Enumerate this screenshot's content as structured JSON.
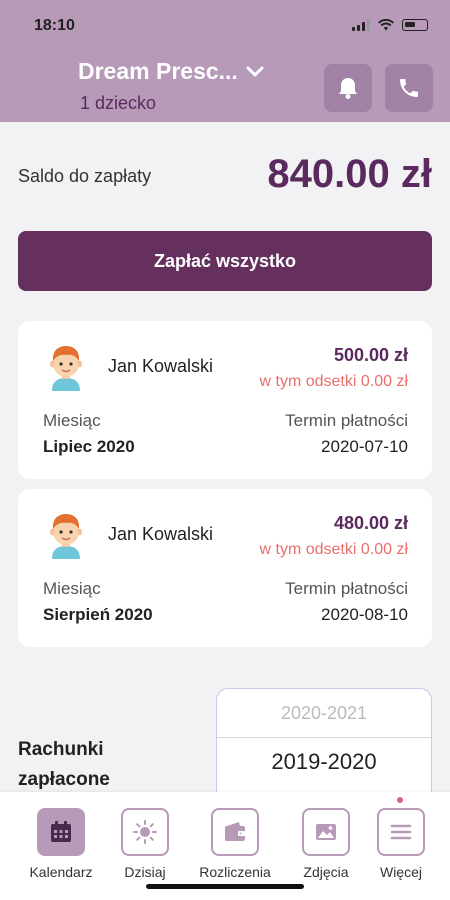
{
  "status_bar": {
    "time": "18:10"
  },
  "header": {
    "school_name": "Dream Presc...",
    "children_count": "1 dziecko"
  },
  "balance": {
    "label": "Saldo do zapłaty",
    "value": "840.00 zł"
  },
  "pay_all_label": "Zapłać wszystko",
  "payments": [
    {
      "child_name": "Jan Kowalski",
      "amount": "500.00 zł",
      "interest": "w tym odsetki 0.00 zł",
      "month_label": "Miesiąc",
      "month_value": "Lipiec 2020",
      "due_label": "Termin płatności",
      "due_value": "2020-07-10"
    },
    {
      "child_name": "Jan Kowalski",
      "amount": "480.00 zł",
      "interest": "w tym odsetki 0.00 zł",
      "month_label": "Miesiąc",
      "month_value": "Sierpień 2020",
      "due_label": "Termin płatności",
      "due_value": "2020-08-10"
    }
  ],
  "paid_section": {
    "label_line1": "Rachunki",
    "label_line2": "zapłacone",
    "year_options": [
      "2020-2021",
      "2019-2020"
    ],
    "selected_year": "2019-2020"
  },
  "tabs": [
    {
      "label": "Kalendarz",
      "icon": "calendar-icon",
      "active": true
    },
    {
      "label": "Dzisiaj",
      "icon": "sun-icon",
      "active": false
    },
    {
      "label": "Rozliczenia",
      "icon": "wallet-icon",
      "active": false
    },
    {
      "label": "Zdjęcia",
      "icon": "image-icon",
      "active": false
    },
    {
      "label": "Więcej",
      "icon": "menu-icon",
      "active": false
    }
  ],
  "colors": {
    "header": "#b79ab8",
    "primary": "#65305e",
    "amount": "#5a2a5e",
    "interest": "#e8706a"
  }
}
